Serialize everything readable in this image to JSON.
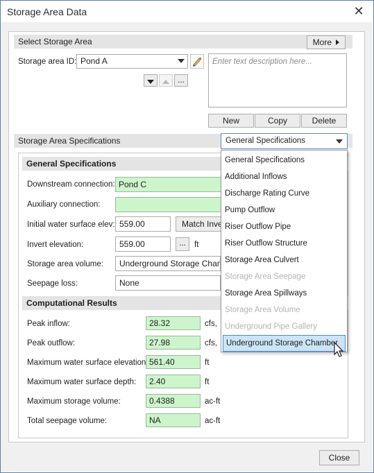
{
  "window": {
    "title": "Storage Area Data",
    "close_label": "✕"
  },
  "select_section": {
    "header": "Select Storage Area",
    "more_label": "More",
    "id_label": "Storage area ID:",
    "id_value": "Pond A",
    "description_placeholder": "Enter text description here...",
    "new_label": "New",
    "copy_label": "Copy",
    "delete_label": "Delete",
    "dots_label": "..."
  },
  "specs_section": {
    "header": "Storage Area Specifications",
    "dropdown_value": "General Specifications",
    "dropdown_options": [
      {
        "label": "General Specifications",
        "enabled": true
      },
      {
        "label": "Additional Inflows",
        "enabled": true
      },
      {
        "label": "Discharge Rating Curve",
        "enabled": true
      },
      {
        "label": "Pump Outflow",
        "enabled": true
      },
      {
        "label": "Riser Outflow Pipe",
        "enabled": true
      },
      {
        "label": "Riser Outflow Structure",
        "enabled": true
      },
      {
        "label": "Storage Area Culvert",
        "enabled": true
      },
      {
        "label": "Storage Area Seepage",
        "enabled": false
      },
      {
        "label": "Storage Area Spillways",
        "enabled": true
      },
      {
        "label": "Storage Area Volume",
        "enabled": false
      },
      {
        "label": "Underground Pipe Gallery",
        "enabled": false
      },
      {
        "label": "Underground Storage Chamber",
        "enabled": true,
        "highlighted": true
      }
    ]
  },
  "general": {
    "header": "General Specifications",
    "downstream_label": "Downstream connection:",
    "downstream_value": "Pond C",
    "auxiliary_label": "Auxiliary connection:",
    "auxiliary_value": "",
    "initial_label": "Initial water surface elev:",
    "initial_value": "559.00",
    "match_label": "Match Inve",
    "invert_label": "Invert elevation:",
    "invert_value": "559.00",
    "invert_unit": "ft",
    "dots_label": "...",
    "volume_label": "Storage area volume:",
    "volume_value": "Underground Storage Chambe",
    "seepage_label": "Seepage loss:",
    "seepage_value": "None"
  },
  "results": {
    "header": "Computational Results",
    "rows": [
      {
        "label": "Peak inflow:",
        "value": "28.32",
        "unit": "cfs,"
      },
      {
        "label": "Peak outflow:",
        "value": "27.98",
        "unit": "cfs,"
      },
      {
        "label": "Maximum water surface elevation:",
        "value": "561.40",
        "unit": "ft"
      },
      {
        "label": "Maximum water surface depth:",
        "value": "2.40",
        "unit": "ft"
      },
      {
        "label": "Maximum storage volume:",
        "value": "0.4388",
        "unit": "ac-ft"
      },
      {
        "label": "Total seepage volume:",
        "value": "NA",
        "unit": "ac-ft"
      }
    ]
  },
  "footer": {
    "close_label": "Close"
  },
  "colors": {
    "accent": "#4a8ad4",
    "green_field": "#ccf5cc",
    "section_bg": "#e4e4e4"
  }
}
